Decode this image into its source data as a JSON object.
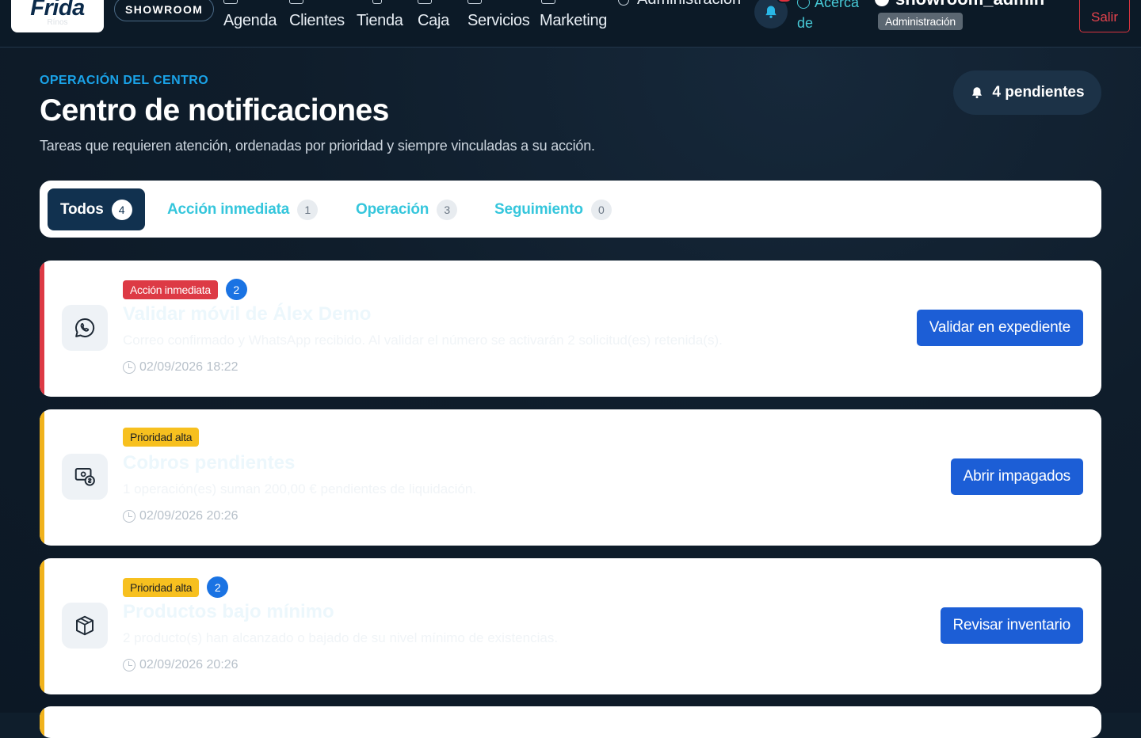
{
  "brand": {
    "logo": "Frida",
    "logo_sub": "Rínos",
    "store": "SHOWROOM"
  },
  "nav": {
    "items": [
      {
        "label": "Agenda",
        "icon": "calendar-icon"
      },
      {
        "label": "Clientes",
        "icon": "users-icon"
      },
      {
        "label": "Tienda",
        "icon": "cart-icon"
      },
      {
        "label": "Caja",
        "icon": "cash-register-icon"
      },
      {
        "label": "Servicios",
        "icon": "scissors-icon"
      },
      {
        "label": "Marketing",
        "icon": "megaphone-icon"
      }
    ],
    "admin": "Administración",
    "about_line1": "Acerca",
    "about_line2": "de",
    "user": "showroom_admin",
    "role": "Administración",
    "logout": "Salir"
  },
  "header": {
    "eyebrow": "OPERACIÓN DEL CENTRO",
    "title": "Centro de notificaciones",
    "subtitle": "Tareas que requieren atención, ordenadas por prioridad y siempre vinculadas a su acción.",
    "pending": "4 pendientes"
  },
  "tabs": [
    {
      "label": "Todos",
      "count": "4",
      "active": true
    },
    {
      "label": "Acción inmediata",
      "count": "1"
    },
    {
      "label": "Operación",
      "count": "3"
    },
    {
      "label": "Seguimiento",
      "count": "0"
    }
  ],
  "notifications": [
    {
      "tag": "Acción inmediata",
      "tag_color": "#dd3a45",
      "count": "2",
      "title": "Validar móvil de Álex Demo",
      "desc": "Correo confirmado y WhatsApp recibido. Al validar el número se activarán 2 solicitud(es) retenida(s).",
      "time": "02/09/2026 18:22",
      "action": "Validar en expediente",
      "icon": "whatsapp-icon",
      "accent": "#dd3a45"
    },
    {
      "tag": "Prioridad alta",
      "tag_color": "#f7c01f",
      "title": "Cobros pendientes",
      "desc": "1 operación(es) suman 200,00 € pendientes de liquidación.",
      "time": "02/09/2026 20:26",
      "action": "Abrir impagados",
      "icon": "payment-icon",
      "accent": "#f0b21c"
    },
    {
      "tag": "Prioridad alta",
      "tag_color": "#f7c01f",
      "count": "2",
      "title": "Productos bajo mínimo",
      "desc": "2 producto(s) han alcanzado o bajado de su nivel mínimo de existencias.",
      "time": "02/09/2026 20:26",
      "action": "Revisar inventario",
      "icon": "box-icon",
      "accent": "#f0b21c"
    }
  ],
  "colors": {
    "background": "#0f1e2c",
    "accent_blue": "#1c5ed6",
    "tab_cyan": "#35c6dc",
    "danger": "#dd3a45",
    "warning": "#f7c01f"
  }
}
